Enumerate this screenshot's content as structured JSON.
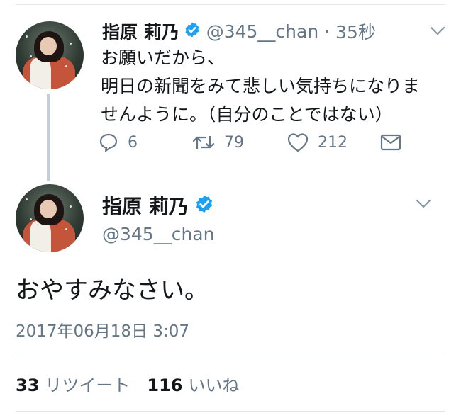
{
  "reply_tweet": {
    "name": "指原 莉乃",
    "handle": "@345__chan",
    "time": "35秒",
    "separator": "·",
    "text_lines": [
      "お願いだから、",
      "明日の新聞をみて悲しい気持ちになりま",
      "せんように。（自分のことではない）"
    ],
    "actions": {
      "reply_count": "6",
      "retweet_count": "79",
      "like_count": "212"
    }
  },
  "main_tweet": {
    "name": "指原 莉乃",
    "handle": "@345__chan",
    "text": "おやすみなさい。",
    "timestamp": "2017年06月18日 3:07",
    "stats": {
      "retweets_count": "33",
      "retweets_label": "リツイート",
      "likes_count": "116",
      "likes_label": "いいね"
    }
  },
  "colors": {
    "verified": "#1da1f2",
    "muted": "#657786",
    "text": "#14171a",
    "divider": "#e1e8ed"
  },
  "icons": [
    "reply-icon",
    "retweet-icon",
    "like-icon",
    "message-icon",
    "verified-badge-icon",
    "chevron-down-icon"
  ]
}
